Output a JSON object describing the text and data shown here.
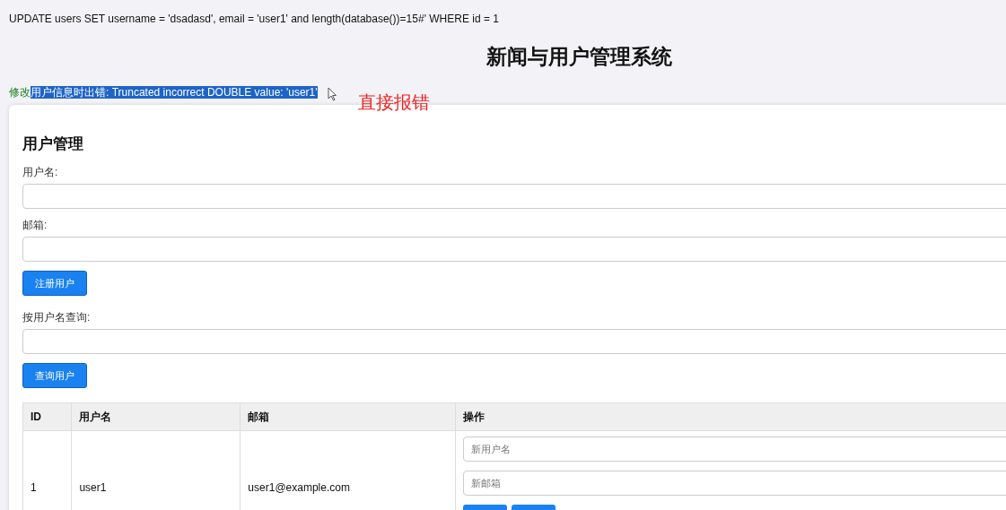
{
  "query_log": "UPDATE users SET username = 'dsadasd', email = 'user1' and length(database())=15#' WHERE id = 1",
  "title": "新闻与用户管理系统",
  "message": [
    {
      "text": "修改",
      "selected": false
    },
    {
      "text": "用户信息时出错: Truncated incorrect DOUBLE value: 'user1'",
      "selected": true
    }
  ],
  "annotation": "直接报错",
  "panel": {
    "heading": "用户管理",
    "register_form": {
      "fields": [
        {
          "label": "用户名:"
        },
        {
          "label": "邮箱:"
        }
      ],
      "button": "注册用户"
    },
    "search_form": {
      "label": "按用户名查询:",
      "button": "查询用户"
    },
    "table": {
      "columns": [
        "ID",
        "用户名",
        "邮箱",
        "操作"
      ],
      "rows": [
        {
          "id": "1",
          "username": "user1",
          "email": "user1@example.com",
          "edit_fields": [
            {
              "placeholder": "新用户名"
            },
            {
              "placeholder": "新邮箱"
            }
          ]
        }
      ]
    }
  }
}
